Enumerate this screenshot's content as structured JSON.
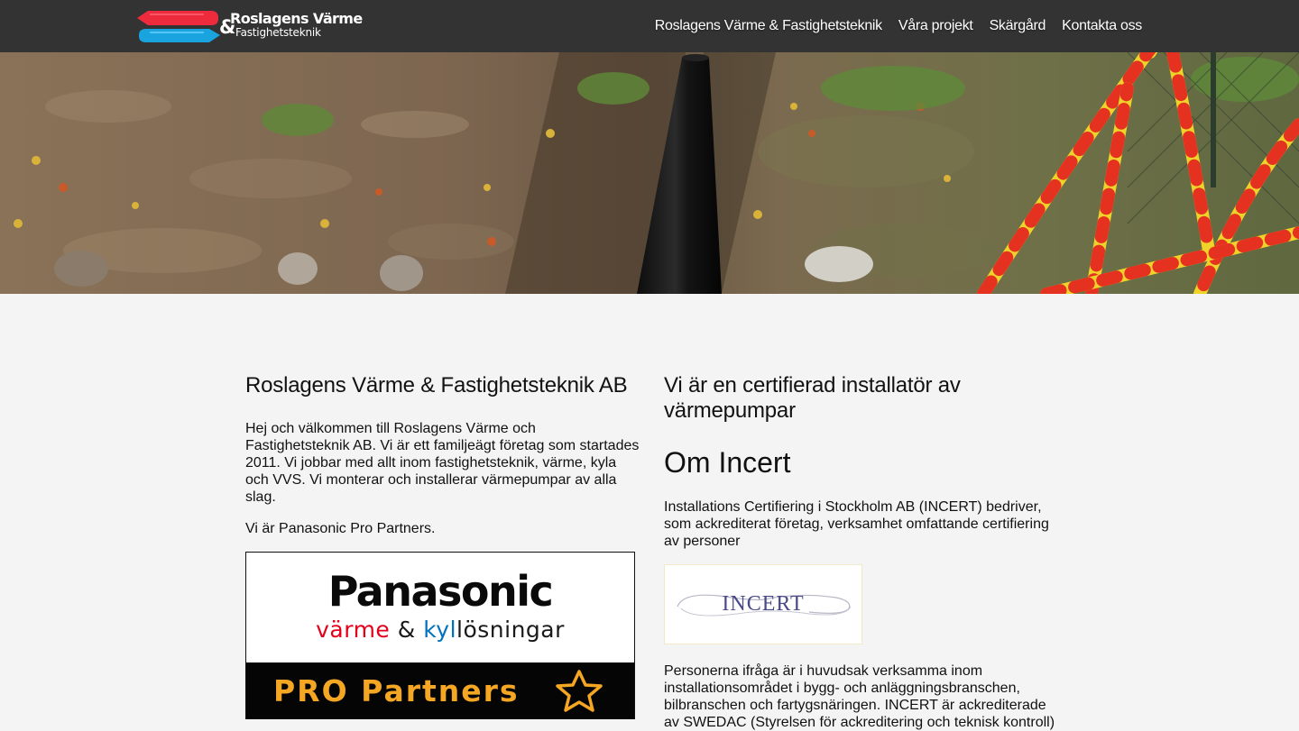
{
  "nav": {
    "logo": {
      "line1": "Roslagens Värme",
      "amp": "&",
      "line2": "Fastighetsteknik"
    },
    "links": [
      "Roslagens Värme & Fastighetsteknik",
      "Våra projekt",
      "Skärgård",
      "Kontakta oss"
    ]
  },
  "hero": {
    "alt_icon": "trench-pipe-photo"
  },
  "left": {
    "heading": "Roslagens Värme & Fastighetsteknik AB",
    "intro": "Hej och välkommen till Roslagens Värme och Fastighetsteknik AB. Vi är ett familjeägt företag som startades 2011. Vi jobbar med allt inom fastighetsteknik, värme, kyla och VVS. Vi monterar och installerar värmepumpar av alla slag.",
    "partners": "Vi är Panasonic Pro Partners.",
    "panasonic_logo": {
      "brand": "Panasonic",
      "sub_red": "värme",
      "sub_and": " & ",
      "sub_blue": "kyl",
      "sub_rest": "lösningar",
      "pro": "PRO Partners"
    }
  },
  "right": {
    "heading": "Vi är en certifierad installatör av värmepumpar",
    "subheading": "Om Incert",
    "p1": "Installations Certifiering i Stockholm AB (INCERT) bedriver, som ackrediterat företag, verksamhet omfattande certifiering av personer",
    "incert_logo": "INCERT",
    "p2": "Personerna ifråga är i huvudsak verksamma inom installationsområdet i bygg- och anläggningsbranschen, bilbranschen och fartygsnäringen. INCERT är ackrediterade av SWEDAC (Styrelsen för ackreditering och teknisk kontroll)"
  }
}
